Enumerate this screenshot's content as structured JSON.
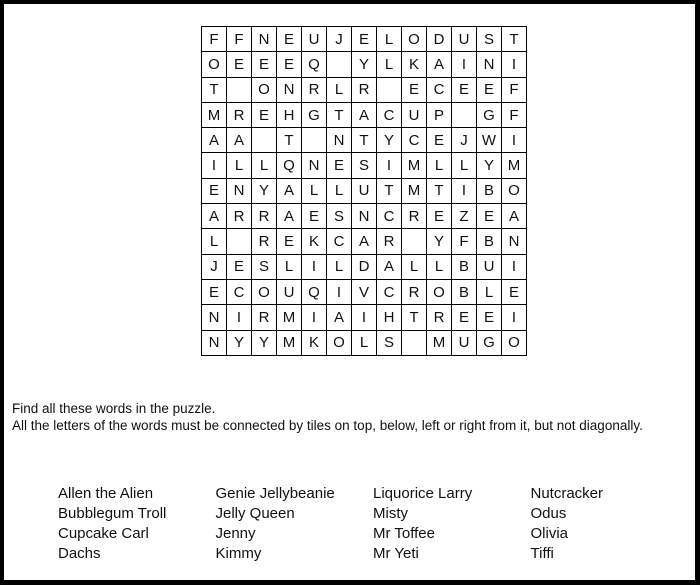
{
  "puzzle": {
    "grid": [
      [
        "F",
        "F",
        "N",
        "E",
        "U",
        "J",
        "E",
        "L",
        "O",
        "D",
        "U",
        "S",
        "T"
      ],
      [
        "O",
        "E",
        "E",
        "E",
        "Q",
        "",
        "Y",
        "L",
        "K",
        "A",
        "I",
        "N",
        "I"
      ],
      [
        "T",
        "",
        "O",
        "N",
        "R",
        "L",
        "R",
        "",
        "E",
        "C",
        "E",
        "E",
        "F"
      ],
      [
        "M",
        "R",
        "E",
        "H",
        "G",
        "T",
        "A",
        "C",
        "U",
        "P",
        "",
        "G",
        "F"
      ],
      [
        "A",
        "A",
        "",
        "T",
        "",
        "N",
        "T",
        "Y",
        "C",
        "E",
        "J",
        "W",
        "I"
      ],
      [
        "I",
        "L",
        "L",
        "Q",
        "N",
        "E",
        "S",
        "I",
        "M",
        "L",
        "L",
        "Y",
        "M"
      ],
      [
        "E",
        "N",
        "Y",
        "A",
        "L",
        "L",
        "U",
        "T",
        "M",
        "T",
        "I",
        "B",
        "O"
      ],
      [
        "A",
        "R",
        "R",
        "A",
        "E",
        "S",
        "N",
        "C",
        "R",
        "E",
        "Z",
        "E",
        "A"
      ],
      [
        "L",
        "",
        "R",
        "E",
        "K",
        "C",
        "A",
        "R",
        "",
        "Y",
        "F",
        "B",
        "N"
      ],
      [
        "J",
        "E",
        "S",
        "L",
        "I",
        "L",
        "D",
        "A",
        "L",
        "L",
        "B",
        "U",
        "I"
      ],
      [
        "E",
        "C",
        "O",
        "U",
        "Q",
        "I",
        "V",
        "C",
        "R",
        "O",
        "B",
        "L",
        "E"
      ],
      [
        "N",
        "I",
        "R",
        "M",
        "I",
        "A",
        "I",
        "H",
        "T",
        "R",
        "E",
        "E",
        "I"
      ],
      [
        "N",
        "Y",
        "Y",
        "M",
        "K",
        "O",
        "L",
        "S",
        "",
        "M",
        "U",
        "G",
        "O"
      ]
    ]
  },
  "instructions": {
    "line1": "Find all these words in the puzzle.",
    "line2": "All the letters of the words must be connected by tiles on top, below, left or right from it, but not diagonally."
  },
  "word_columns": [
    [
      "Allen the Alien",
      "Bubblegum Troll",
      "Cupcake Carl",
      "Dachs"
    ],
    [
      "Genie Jellybeanie",
      "Jelly Queen",
      "Jenny",
      "Kimmy"
    ],
    [
      "Liquorice Larry",
      "Misty",
      "Mr Toffee",
      "Mr Yeti"
    ],
    [
      "Nutcracker",
      "Odus",
      "Olivia",
      "Tiffi"
    ]
  ]
}
